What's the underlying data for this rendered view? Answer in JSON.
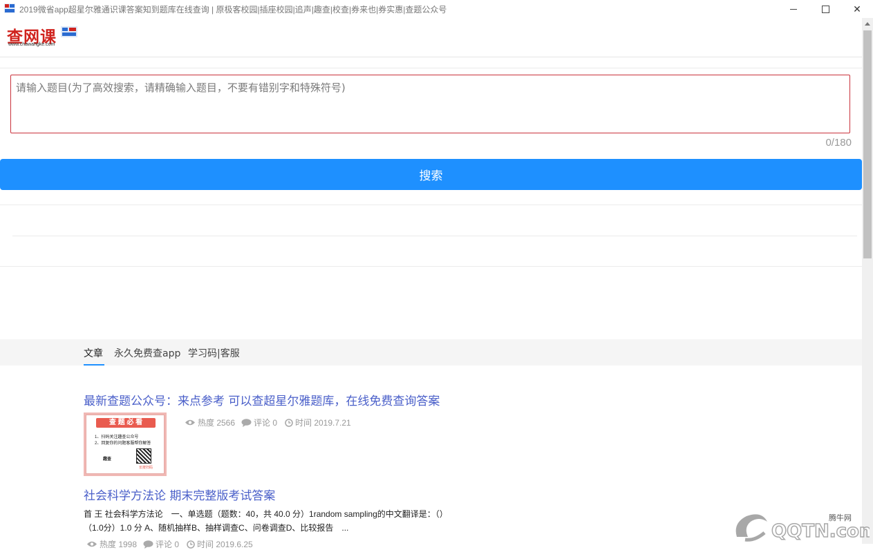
{
  "window": {
    "title": "2019微省app超星尔雅通识课答案知到题库在线查询 | 原极客校园|插座校园|追声|趣查|校查|券来也|券实惠|查题公众号",
    "minimize_label": "",
    "maximize_label": "",
    "close_label": "✕"
  },
  "header": {
    "logo_text": "查网课",
    "logo_url": "www.chawangke.com"
  },
  "search": {
    "placeholder": "请输入题目(为了高效搜索，请精确输入题目，不要有错别字和特殊符号)",
    "value": "",
    "counter": "0/180",
    "button_label": "搜索"
  },
  "tabs": [
    {
      "label": "文章",
      "active": true
    },
    {
      "label": "永久免费查app",
      "active": false
    },
    {
      "label": "学习码|客服",
      "active": false
    }
  ],
  "articles": [
    {
      "title": "最新查题公众号：来点参考 可以查超星尔雅题库，在线免费查询答案",
      "thumbnail": {
        "heading": "查 题 必 看",
        "line1": "1、扫码关注趣查公众号",
        "line2": "2、回复你的问题客服帮你解答",
        "brand": "趣查",
        "sub": "长按扫码"
      },
      "views": "热度 2566",
      "comments": "评论 0",
      "time": "时间 2019.7.21"
    },
    {
      "title": "社会科学方法论 期末完整版考试答案",
      "excerpt_line1": "首 王 社会科学方法论　一、单选题（题数：40，共 40.0 分）1random sampling的中文翻译是：（）",
      "excerpt_line2": "（1.0分）1.0 分 A、随机抽样B、抽样调查C、问卷调查D、比较报告　...",
      "views": "热度 1998",
      "comments": "评论 0",
      "time": "时间 2019.6.25"
    }
  ],
  "watermark": {
    "cn": "腾牛网",
    "en": "QQTN.com"
  },
  "colors": {
    "accent": "#1e90ff",
    "input_border": "#c9303a",
    "article_title": "#4a5fc9",
    "logo_red": "#d0231e"
  }
}
